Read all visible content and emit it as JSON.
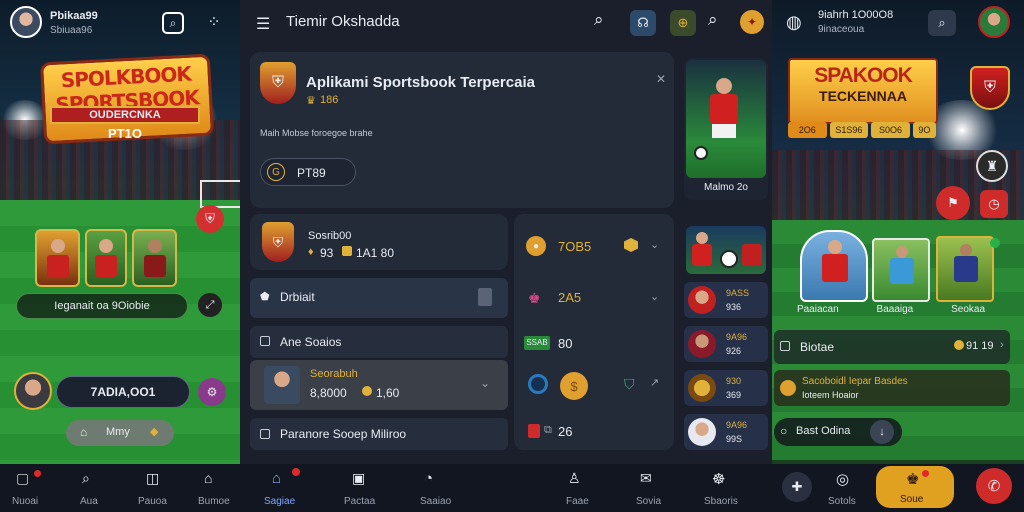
{
  "left": {
    "username": "Pbikaa99",
    "subtitle": "Sbiuaa96",
    "logo_line1": "SPOLKBOOK",
    "logo_line2": "SPORTSBOOK",
    "logo_ribbon": "OUDERCNKA",
    "logo_sub": "PT1O",
    "banner_text": "Ieganait oa 9Oiobie",
    "balance": "7ADIA,OO1",
    "menu_label": "Mmy",
    "nav": [
      "Nuoai",
      "Aua",
      "Pauoa",
      "Bumoe"
    ]
  },
  "center": {
    "title": "Tiemir Okshadda",
    "hero": {
      "title": "Aplikami Sportsbook Terpercaia",
      "badge": "186",
      "desc": "Maih Mobse foroegoe brahe",
      "code": "PT89",
      "code_icon": "G"
    },
    "promo_card": {
      "caption": "Malmo 2o"
    },
    "stats": {
      "title": "Sosrib00",
      "v1": "93",
      "v2": "1A1 80"
    },
    "rows": [
      {
        "label": "Drbiait"
      },
      {
        "label": "Ane Soaios"
      },
      {
        "title": "Seorabuh",
        "value": "8,8000",
        "extra": "1,60"
      },
      {
        "label": "Paranore Sooep Miliroo"
      }
    ],
    "odds": [
      {
        "value": "7OB5"
      },
      {
        "value": "2A5"
      },
      {
        "badge": "SSAB",
        "value": "80"
      },
      {
        "value": ""
      },
      {
        "value": "26"
      }
    ],
    "list": [
      {
        "l1": "9ASS",
        "l2": "936"
      },
      {
        "l1": "9A96",
        "l2": "926"
      },
      {
        "l1": "930",
        "l2": "369"
      },
      {
        "l1": "9A96",
        "l2": "99S"
      }
    ],
    "nav": [
      "Sagiae",
      "Pactaa",
      "Saaiao",
      "Faae",
      "Sovia",
      "Sbaoris"
    ]
  },
  "right": {
    "username": "9iahrh 1O00O8",
    "subtitle": "9inaceoua",
    "logo_line1": "SPAKOOK",
    "logo_line2": "TECKENNAA",
    "chips": [
      "2O6",
      "S1S96",
      "S0O6",
      "9O"
    ],
    "players": [
      "Paaiacan",
      "Baaaiga",
      "Seokaa"
    ],
    "row1_label": "Biotae",
    "row1_value": "91 19",
    "row2_label": "Sacoboidl Iepar Basdes",
    "row2_sub": "Ioteem Hoaior",
    "row3_label": "Bast Odina",
    "nav": [
      "Sotols",
      "Soue"
    ]
  },
  "colors": {
    "accent": "#7ea6ff",
    "gold": "#e0b23a",
    "red": "#d02b2b"
  }
}
